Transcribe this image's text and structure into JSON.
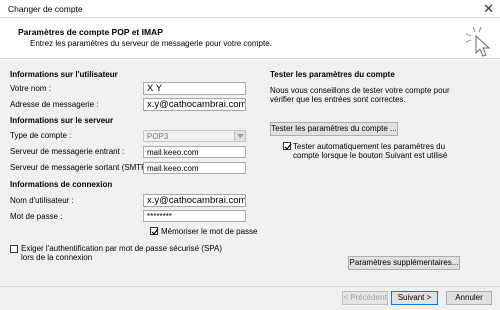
{
  "window": {
    "title": "Changer de compte"
  },
  "header": {
    "title": "Paramètres de compte POP et IMAP",
    "subtitle": "Entrez les paramètres du serveur de messagerie pour votre compte."
  },
  "user_info": {
    "heading": "Informations sur l'utilisateur",
    "name_label": "Votre nom :",
    "name_value": "X  Y",
    "email_label": "Adresse de messagerie :",
    "email_value": "x.y@cathocambrai.com"
  },
  "server_info": {
    "heading": "Informations sur le serveur",
    "type_label": "Type de compte :",
    "type_value": "POP3",
    "incoming_label": "Serveur de messagerie entrant :",
    "incoming_value": "mail.keeo.com",
    "outgoing_label": "Serveur de messagerie sortant (SMTP) :",
    "outgoing_value": "mail.keeo.com"
  },
  "login_info": {
    "heading": "Informations de connexion",
    "username_label": "Nom d'utilisateur :",
    "username_value": "x.y@cathocambrai.com",
    "password_label": "Mot de passe :",
    "password_value": "********",
    "remember_label": "Mémoriser le mot de passe",
    "remember_checked": true,
    "spa_label_line1": "Exiger l'authentification par mot de passe sécurisé (SPA)",
    "spa_label_line2": "lors de la connexion",
    "spa_checked": false
  },
  "test": {
    "heading": "Tester les paramètres du compte",
    "desc_line1": "Nous vous conseillons de tester votre compte pour",
    "desc_line2": "vérifier que les entrées sont correctes.",
    "test_button": "Tester les paramètres du compte ...",
    "auto_label_line1": "Tester automatiquement les paramètres du",
    "auto_label_line2": "compte lorsque le bouton Suivant est utilisé",
    "auto_checked": true,
    "more_settings_button": "Paramètres supplémentaires..."
  },
  "footer": {
    "prev_button": "< Précédent",
    "next_button": "Suivant >",
    "cancel_button": "Annuler"
  }
}
